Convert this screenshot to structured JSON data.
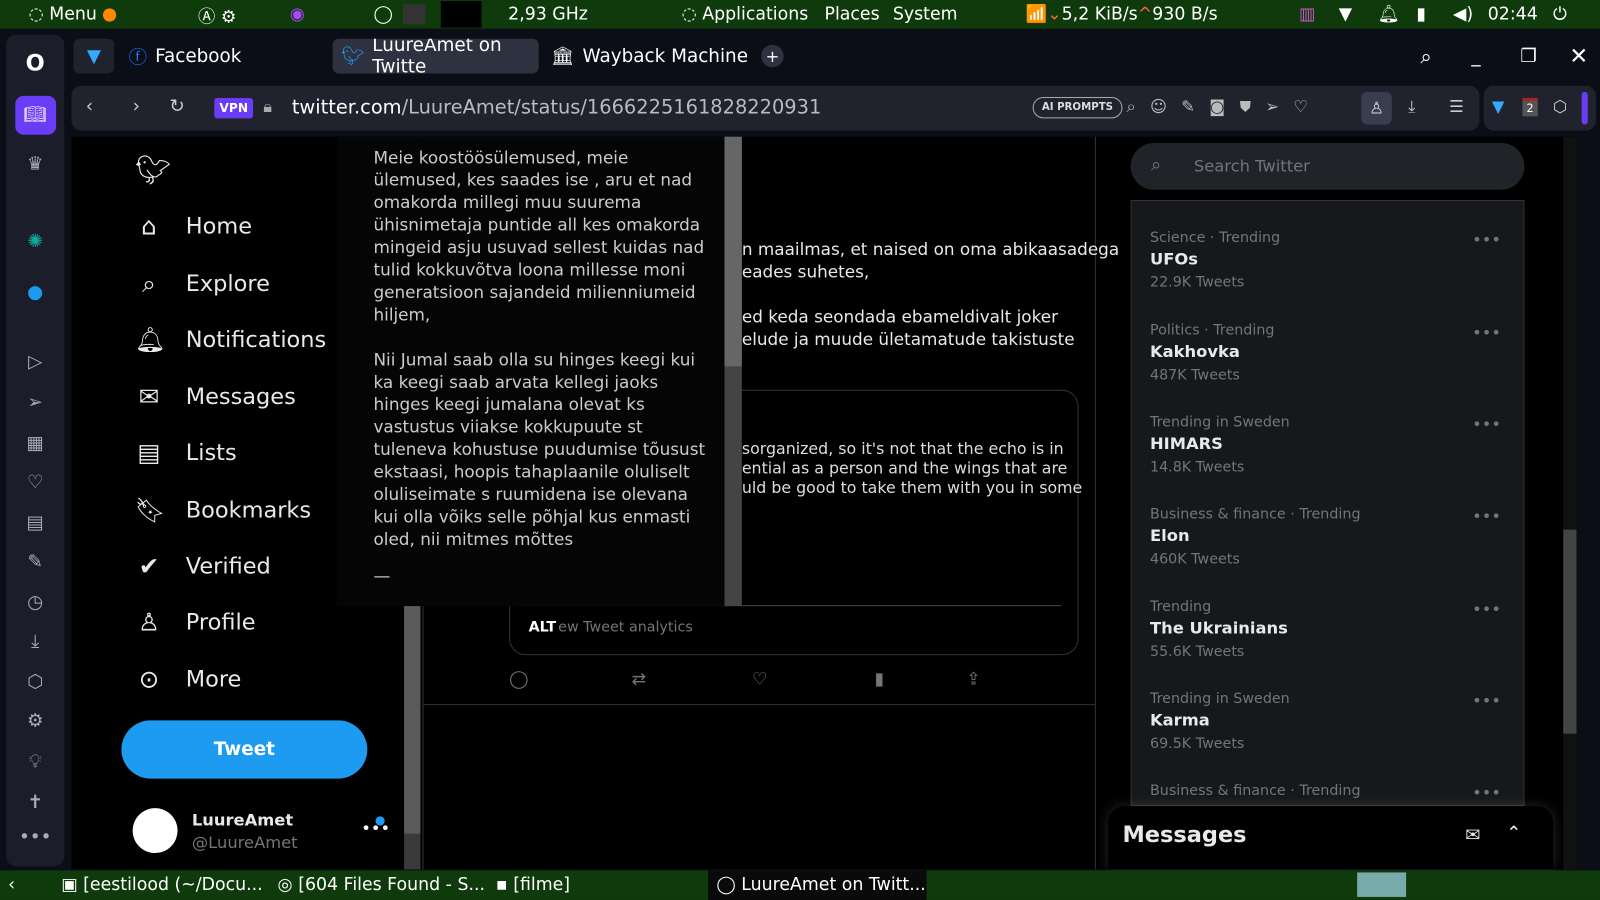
{
  "system_panel": {
    "menu": "Menu",
    "cpu": "2,93 GHz",
    "applications": "Applications",
    "places": "Places",
    "system": "System",
    "net_down": "5,2 KiB/s",
    "net_up": "930 B/s",
    "clock": "02:44"
  },
  "browser": {
    "tabs": [
      {
        "label": "Facebook"
      },
      {
        "label": "LuureAmet on Twitte"
      },
      {
        "label": "Wayback Machine"
      }
    ],
    "new_tab": "+",
    "vpn": "VPN",
    "url_host": "twitter.com",
    "url_path": "/LuureAmet/status/1666225161828220931",
    "ai_prompts": "AI PROMPTS",
    "ext_badge": "2"
  },
  "twitter": {
    "nav": [
      {
        "label": "Home"
      },
      {
        "label": "Explore"
      },
      {
        "label": "Notifications"
      },
      {
        "label": "Messages"
      },
      {
        "label": "Lists"
      },
      {
        "label": "Bookmarks"
      },
      {
        "label": "Verified"
      },
      {
        "label": "Profile"
      },
      {
        "label": "More"
      }
    ],
    "tweet_button": "Tweet",
    "account": {
      "name": "LuureAmet",
      "handle": "@LuureAmet"
    },
    "search_placeholder": "Search Twitter",
    "tweet_lines": [
      "n maailmas, et naised on oma abikaasadega",
      "eades suhetes,",
      "ed keda seondada ebameldivalt joker",
      "elude ja muude ületamatude takistuste"
    ],
    "quote_lines": [
      "sorganized, so it's not that the echo is in",
      "ential as a person and the wings that are",
      "uld be good to take them with you in some"
    ],
    "alt": "ALT",
    "analytics": "ew Tweet analytics",
    "trends": [
      {
        "category": "Science · Trending",
        "name": "UFOs",
        "count": "22.9K Tweets"
      },
      {
        "category": "Politics · Trending",
        "name": "Kakhovka",
        "count": "487K Tweets"
      },
      {
        "category": "Trending in Sweden",
        "name": "HIMARS",
        "count": "14.8K Tweets"
      },
      {
        "category": "Business & finance · Trending",
        "name": "Elon",
        "count": "460K Tweets"
      },
      {
        "category": "Trending",
        "name": "The Ukrainians",
        "count": "55.6K Tweets"
      },
      {
        "category": "Trending in Sweden",
        "name": "Karma",
        "count": "69.5K Tweets"
      },
      {
        "category": "Business & finance · Trending",
        "name": "",
        "count": ""
      }
    ],
    "messages_title": "Messages"
  },
  "tooltip": {
    "para1": "Meie koostöösülemused, meie ülemused, kes saades ise , aru et nad omakorda millegi muu suurema ühisnimetaja puntide all kes omakorda mingeid asju usuvad sellest kuidas nad tulid kokkuvõtva loona millesse moni generatsioon sajandeid milienniumeid hiljem,",
    "para2": "Nii Jumal saab olla su hinges keegi kui ka keegi saab arvata kellegi jaoks hinges keegi jumalana olevat ks vastustus viiakse kokkupuute st tuleneva kohustuse puudumise tõusust ekstaasi, hoopis tahaplaanile oluliselt oluliseimate s ruumidena ise olevana kui olla võiks selle põhjal kus enmasti oled, nii mitmes mõttes",
    "tail": "—"
  },
  "taskbar": [
    {
      "label": "[eestilood (~/Docu..."
    },
    {
      "label": "[604 Files Found - S..."
    },
    {
      "label": "[filme]"
    },
    {
      "label": "LuureAmet on Twitt..."
    }
  ],
  "colors": {
    "panel": "#0f3a0b",
    "twitter_blue": "#1d9bf0",
    "opera_accent": "#6b3cf5"
  }
}
